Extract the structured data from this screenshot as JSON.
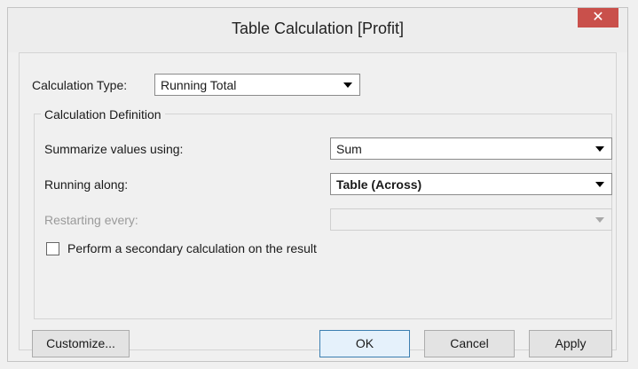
{
  "window": {
    "title": "Table Calculation [Profit]"
  },
  "calc_type": {
    "label": "Calculation Type:",
    "value": "Running Total"
  },
  "definition": {
    "title": "Calculation Definition",
    "summarize": {
      "label": "Summarize values using:",
      "value": "Sum"
    },
    "running_along": {
      "label": "Running along:",
      "value": "Table (Across)"
    },
    "restarting": {
      "label": "Restarting every:",
      "value": ""
    },
    "secondary": {
      "label": "Perform a secondary calculation on the result",
      "checked": false
    }
  },
  "buttons": {
    "customize": "Customize...",
    "ok": "OK",
    "cancel": "Cancel",
    "apply": "Apply"
  },
  "icons": {
    "close": "close-icon"
  },
  "colors": {
    "close_button": "#c9504b"
  }
}
